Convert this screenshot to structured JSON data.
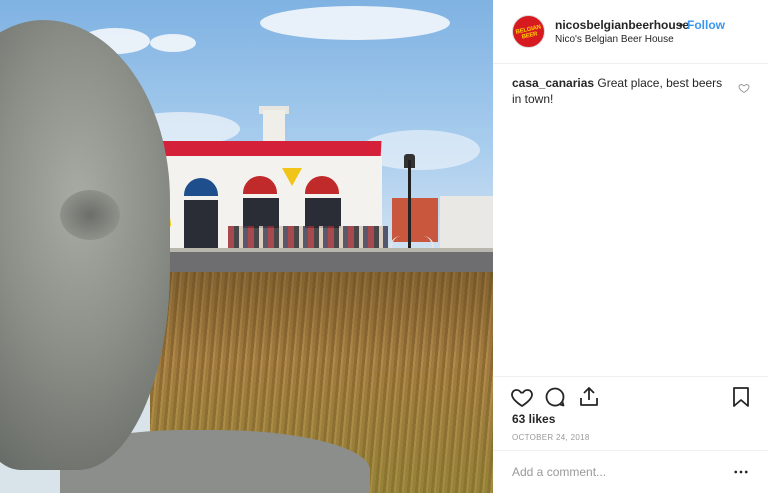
{
  "post": {
    "username": "nicosbelgianbeerhouse",
    "separator": "•",
    "follow_label": "Follow",
    "display_name": "Nico's Belgian Beer House",
    "avatar_text": "BELGIAN BEER"
  },
  "comment": {
    "author": "casa_canarias",
    "text": "Great place, best beers in town!"
  },
  "stats": {
    "likes": "63 likes",
    "date": "OCTOBER 24, 2018"
  },
  "compose": {
    "placeholder": "Add a comment..."
  },
  "icons": {
    "like": "heart-icon",
    "comment": "comment-bubble-icon",
    "share": "share-icon",
    "save": "bookmark-icon",
    "more": "more-options-icon",
    "comment_like": "heart-icon"
  },
  "colors": {
    "accent": "#3897f0",
    "avatar_bg": "#d71920"
  }
}
